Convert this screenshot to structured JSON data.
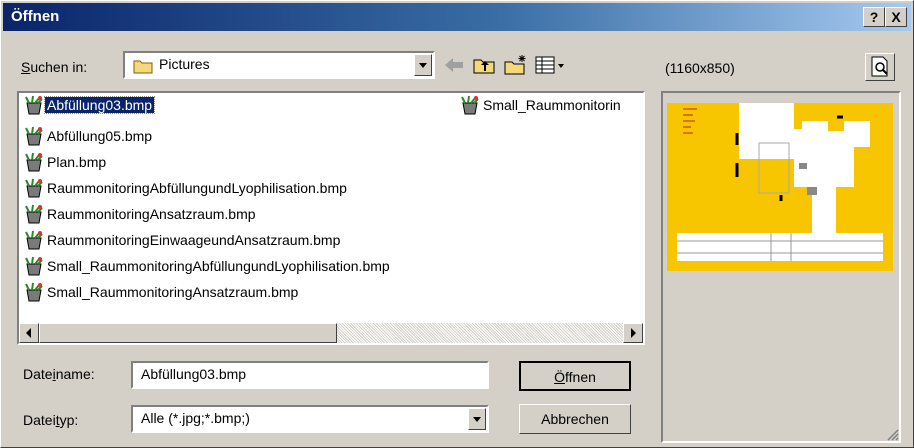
{
  "window": {
    "title": "Öffnen",
    "help_label": "?",
    "close_label": "X"
  },
  "look_in": {
    "label_u": "S",
    "label_rest": "uchen in:",
    "value": "Pictures"
  },
  "toolbar": {
    "back": "back-arrow-icon",
    "up": "up-folder-icon",
    "new_folder": "new-folder-icon",
    "view": "view-menu-icon"
  },
  "preview": {
    "dimensions": "(1160x850)"
  },
  "files": [
    {
      "name": "Abfüllung03.bmp",
      "selected": true
    },
    {
      "name": "Abfüllung05.bmp"
    },
    {
      "name": "Plan.bmp"
    },
    {
      "name": "RaummonitoringAbfüllungundLyophilisation.bmp"
    },
    {
      "name": "RaummonitoringAnsatzraum.bmp"
    },
    {
      "name": "RaummonitoringEinwaageundAnsatzraum.bmp"
    },
    {
      "name": "Small_RaummonitoringAbfüllungundLyophilisation.bmp"
    },
    {
      "name": "Small_RaummonitoringAnsatzraum.bmp"
    },
    {
      "name": "Small_Raummonitorin"
    }
  ],
  "filename": {
    "label_a": "Date",
    "label_u": "i",
    "label_b": "name:",
    "value": "Abfüllung03.bmp"
  },
  "filetype": {
    "label_a": "Datei",
    "label_u": "t",
    "label_b": "yp:",
    "value": "Alle (*.jpg;*.bmp;)"
  },
  "buttons": {
    "open_u": "Ö",
    "open_rest": "ffnen",
    "cancel": "Abbrechen"
  },
  "colors": {
    "title_start": "#0a246a",
    "title_end": "#a6caf0",
    "selection": "#0a246a",
    "preview_bg": "#f7c600"
  }
}
